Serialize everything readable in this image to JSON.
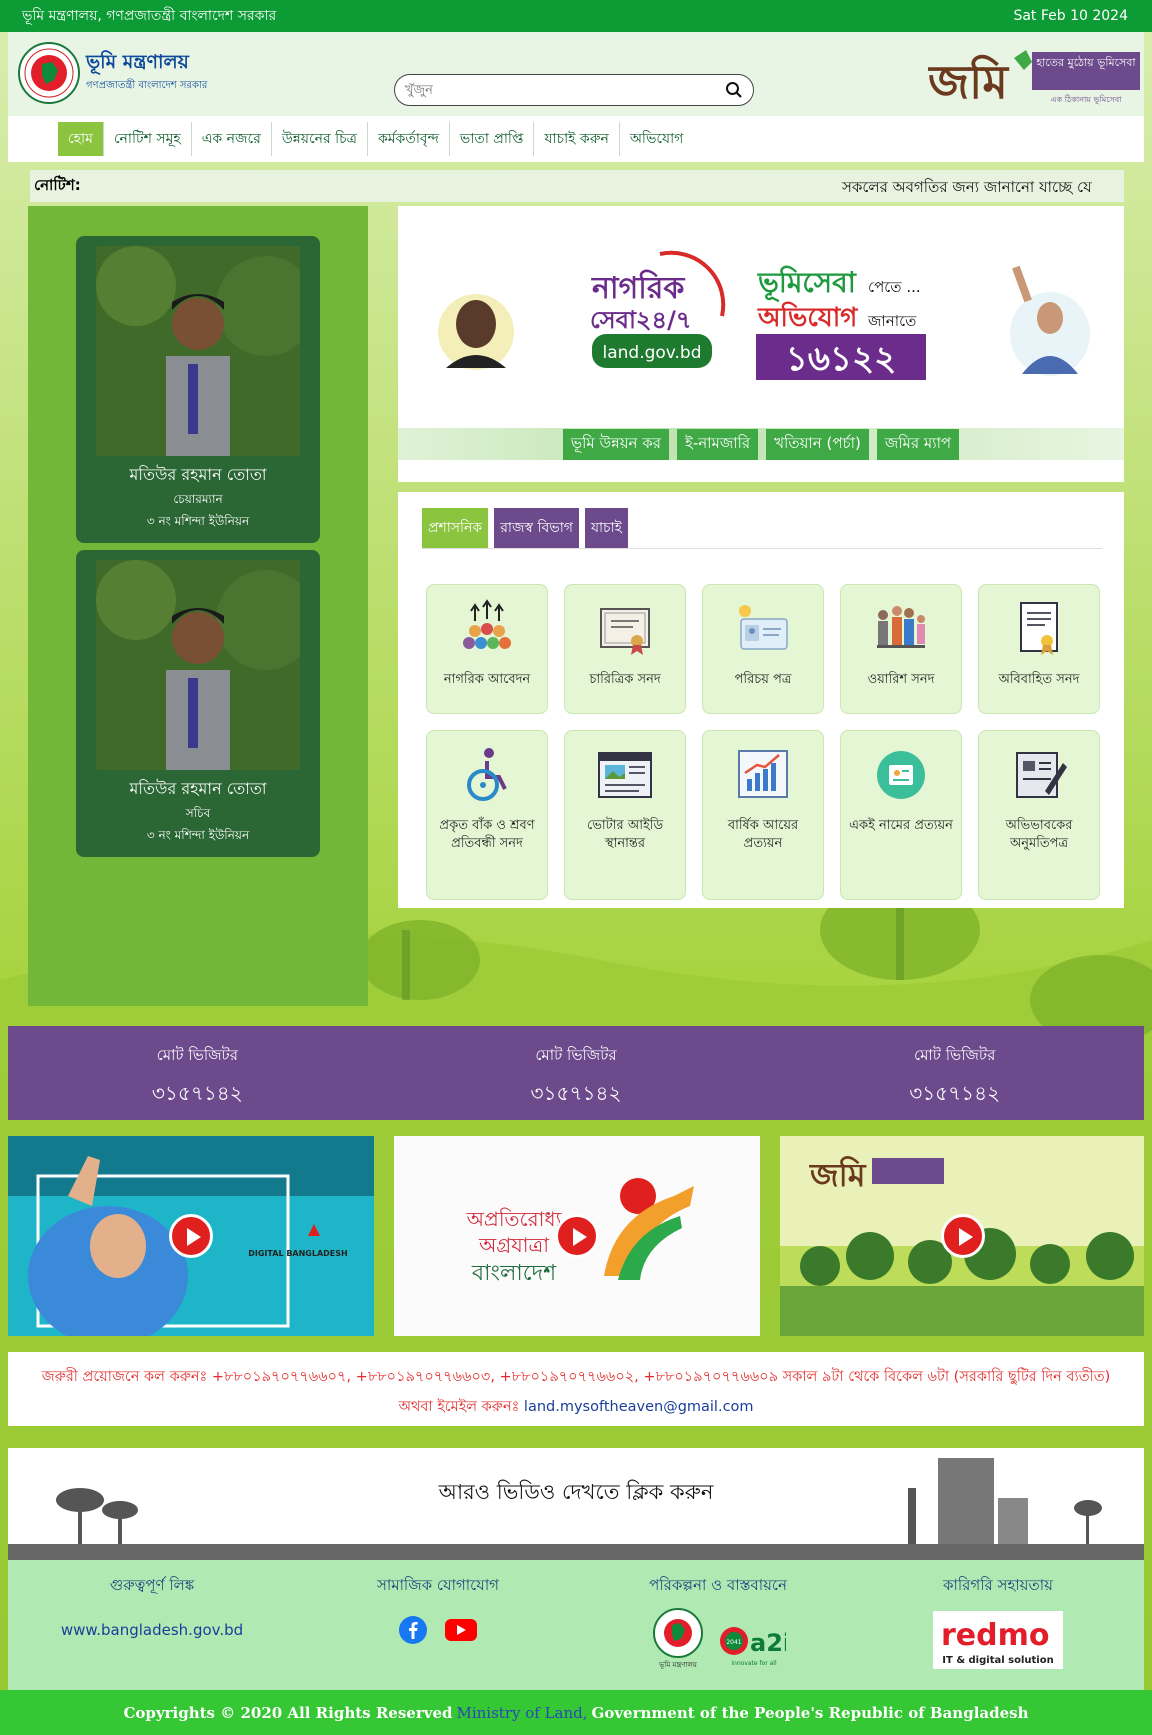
{
  "topbar": {
    "title": "ভূমি মন্ত্রণালয়, গণপ্রজাতন্ত্রী বাংলাদেশ সরকার",
    "date": "Sat Feb 10 2024"
  },
  "header": {
    "ministry_name": "ভূমি মন্ত্রণালয়",
    "ministry_sub": "গণপ্রজাতন্ত্রী বাংলাদেশ সরকার",
    "search_placeholder": "খুঁজুন",
    "jomi_logo_text": "জমি",
    "jomi_tagline": "হাতের মুঠোয় ভূমিসেবা",
    "jomi_small": "এক ঠিকানায় ভূমিসেবা"
  },
  "nav": [
    {
      "label": "হোম",
      "active": true
    },
    {
      "label": "নোটিশ সমূহ",
      "active": false
    },
    {
      "label": "এক নজরে",
      "active": false
    },
    {
      "label": "উন্নয়নের চিত্র",
      "active": false
    },
    {
      "label": "কর্মকর্তাবৃন্দ",
      "active": false
    },
    {
      "label": "ভাতা প্রাপ্তি",
      "active": false
    },
    {
      "label": "যাচাই করুন",
      "active": false
    },
    {
      "label": "অভিযোগ",
      "active": false
    }
  ],
  "notice": {
    "label": "নোটিশ:",
    "text": "সকলের অবগতির জন্য জানানো যাচ্ছে যে"
  },
  "people": [
    {
      "name": "মতিউর রহমান তোতা",
      "role": "চেয়ারম্যান",
      "union": "৩ নং মশিন্দা ইউনিয়ন"
    },
    {
      "name": "মতিউর রহমান তোতা",
      "role": "সচিব",
      "union": "৩ নং মশিন্দা ইউনিয়ন"
    }
  ],
  "banner": {
    "nagorik": "নাগরিক",
    "sheba": "সেবা২৪/৭",
    "site": "land.gov.bd",
    "bhumi_sheba": "ভূমিসেবা",
    "pete": "পেতে ...",
    "obhijog": "অভিযোগ",
    "janate": "জানাতে",
    "hotline": "১৬১২২",
    "links": [
      "ভূমি উন্নয়ন কর",
      "ই-নামজারি",
      "খতিয়ান (পর্চা)",
      "জমির ম্যাপ"
    ]
  },
  "service_tabs": [
    {
      "label": "প্রশাসনিক",
      "color": "#8bc53f"
    },
    {
      "label": "রাজস্ব বিভাগ",
      "color": "#6c4a8c"
    },
    {
      "label": "যাচাই",
      "color": "#6c4a8c"
    }
  ],
  "services": [
    {
      "label": "নাগরিক আবেদন",
      "icon": "people-group-icon"
    },
    {
      "label": "চারিত্রিক সনদ",
      "icon": "certificate-icon"
    },
    {
      "label": "পরিচয় পত্র",
      "icon": "id-card-icon"
    },
    {
      "label": "ওয়ারিশ সনদ",
      "icon": "family-icon"
    },
    {
      "label": "অবিবাহিত সনদ",
      "icon": "document-badge-icon"
    },
    {
      "label": "প্রকৃত বাঁক ও শ্রবণ প্রতিবন্ধী সনদ",
      "icon": "wheelchair-icon"
    },
    {
      "label": "ভোটার আইডি স্থানান্তর",
      "icon": "newspaper-icon"
    },
    {
      "label": "বার্ষিক আয়ের প্রত্যয়ন",
      "icon": "bar-chart-icon"
    },
    {
      "label": "একই নামের প্রত্যয়ন",
      "icon": "id-badge-icon"
    },
    {
      "label": "অভিভাবকের অনুমতিপত্র",
      "icon": "signed-form-icon"
    }
  ],
  "visitors": [
    {
      "label": "মোট ভিজিটর",
      "count": "৩১৫৭১৪২"
    },
    {
      "label": "মোট ভিজিটর",
      "count": "৩১৫৭১৪২"
    },
    {
      "label": "মোট ভিজিটর",
      "count": "৩১৫৭১৪২"
    }
  ],
  "videos": {
    "v1_brand": "DIGITAL BANGLADESH",
    "v2_line1": "অপ্রতিরোধ্য",
    "v2_line2": "অগ্রযাত্রা",
    "v2_line3": "বাংলাদেশ",
    "v3_brand": "জমি"
  },
  "contact": {
    "line1": "জরুরী প্রয়োজনে কল করুনঃ +৮৮০১৯৭০৭৭৬৬০৭, +৮৮০১৯৭০৭৭৬৬০৩, +৮৮০১৯৭০৭৭৬৬০২, +৮৮০১৯৭০৭৭৬৬০৯ সকাল ৯টা থেকে বিকেল ৬টা (সরকারি ছুটির দিন ব্যতীত)",
    "email_label": "অথবা ইমেইল করুনঃ",
    "email": "land.mysoftheaven@gmail.com"
  },
  "more_video": "আরও ভিডিও দেখতে ক্লিক করুন",
  "footer": {
    "links_head": "গুরুত্বপূর্ণ লিঙ্ক",
    "link": "www.bangladesh.gov.bd",
    "social_head": "সামাজিক যোগাযোগ",
    "plan_head": "পরিকল্পনা ও বাস্তবায়নে",
    "ministry_small": "ভূমি মন্ত্রণালয়",
    "a2i": "a2i",
    "a2i_sub": "innovate for all",
    "tech_head": "কারিগরি সহায়তায়",
    "redmo": "redmo",
    "redmo_sub": "IT & digital solution"
  },
  "copyright": {
    "prefix": "Copyrights © 2020 All Rights Reserved",
    "ministry": "Ministry of Land,",
    "suffix": "Government of the People's Republic of Bangladesh"
  },
  "colors": {
    "green_top": "#0d9b36",
    "purple": "#6c4a8c",
    "light_green": "#8bc53f",
    "footer_green": "#35c734"
  }
}
